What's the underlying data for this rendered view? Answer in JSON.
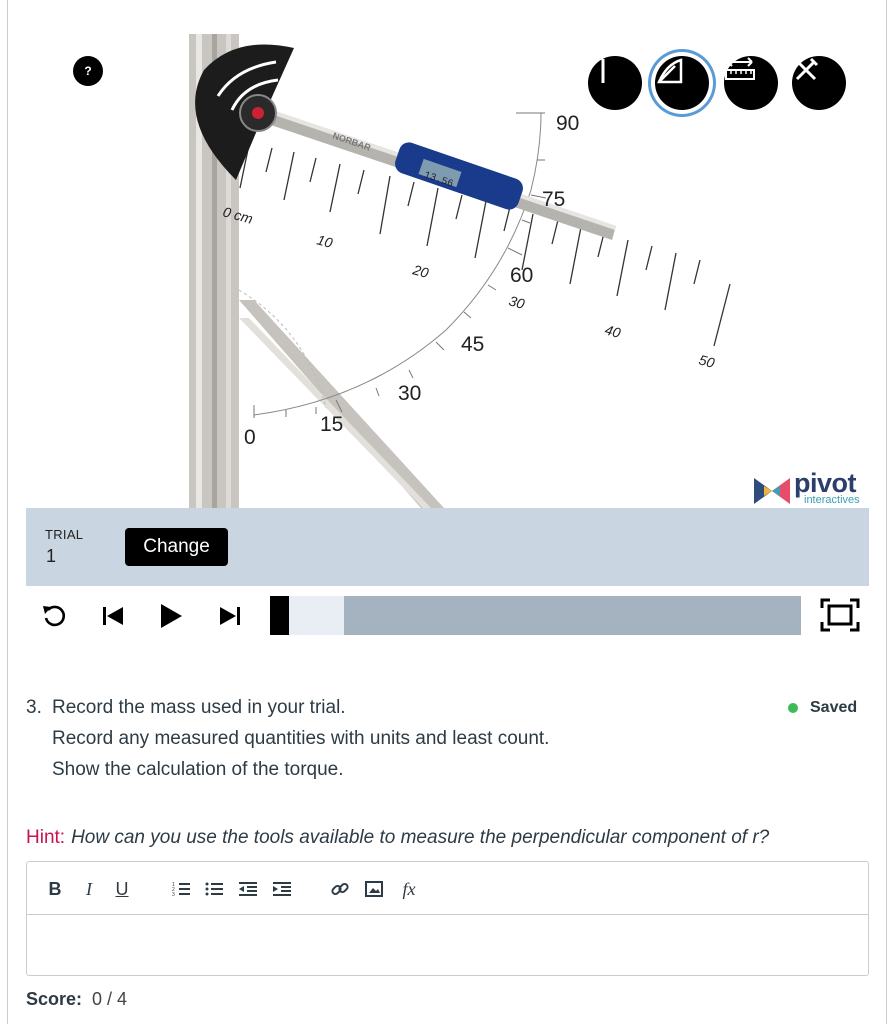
{
  "scene": {
    "help_label": "?",
    "angle_labels": [
      "0",
      "15",
      "30",
      "45",
      "60",
      "75",
      "90"
    ],
    "ruler_labels": [
      "0 cm",
      "10",
      "20",
      "30",
      "40",
      "50"
    ],
    "wrench_display": "13.56",
    "wrench_brand": "NORBAR",
    "tools": [
      {
        "name": "line-tool",
        "active": false
      },
      {
        "name": "protractor-tool",
        "active": true
      },
      {
        "name": "ruler-tool",
        "active": false
      },
      {
        "name": "tools-tool",
        "active": false
      }
    ],
    "logo": {
      "word": "pivot",
      "sub": "interactives"
    }
  },
  "trial": {
    "label": "TRIAL",
    "number": "1",
    "change_label": "Change"
  },
  "player": {
    "buffer_fraction": 0.14,
    "position_fraction": 0.0
  },
  "question": {
    "number": "3.",
    "lines": [
      "Record the mass used in your trial.",
      "Record any measured quantities with units and least count.",
      "Show the calculation of the torque."
    ],
    "status": "Saved",
    "status_color": "#3cba54"
  },
  "hint": {
    "label": "Hint:",
    "text": "How can you use the tools available to measure the perpendicular component of r?"
  },
  "editor": {
    "buttons": [
      "bold",
      "italic",
      "underline",
      "ordered-list",
      "unordered-list",
      "outdent",
      "indent",
      "link",
      "image",
      "equation"
    ],
    "bold_label": "B",
    "italic_label": "I",
    "underline_label": "U",
    "equation_label": "fx",
    "value": ""
  },
  "score": {
    "label": "Score:",
    "value": "0 / 4"
  },
  "colors": {
    "hint": "#c8134d",
    "trial_bar": "#c9d5e0",
    "track": "#a5b2c0",
    "active_ring": "#5b9bd5"
  }
}
